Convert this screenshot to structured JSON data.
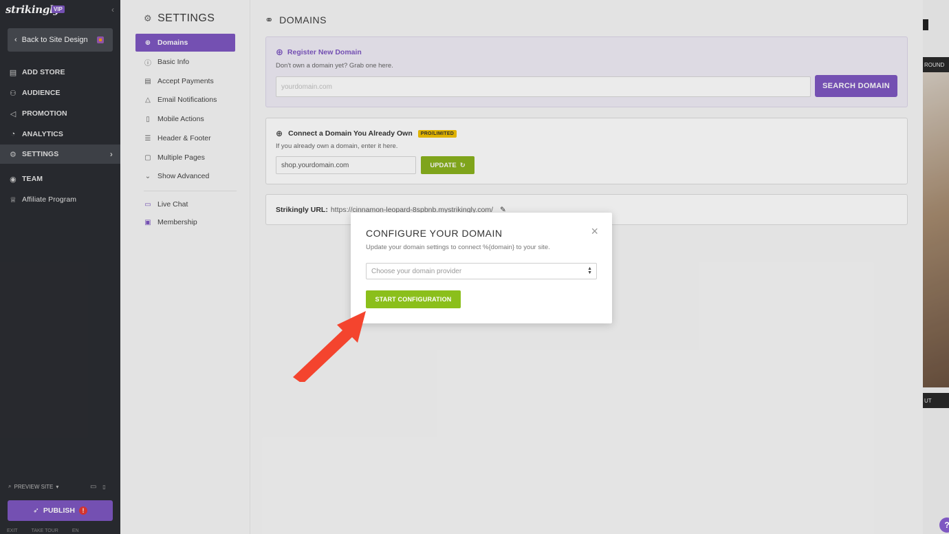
{
  "brand": {
    "name": "strikingly",
    "badge": "VIP"
  },
  "sidebar": {
    "back_label": "Back to Site Design",
    "items": [
      {
        "label": "ADD STORE",
        "icon": "store-icon"
      },
      {
        "label": "AUDIENCE",
        "icon": "audience-icon"
      },
      {
        "label": "PROMOTION",
        "icon": "megaphone-icon"
      },
      {
        "label": "ANALYTICS",
        "icon": "analytics-icon"
      },
      {
        "label": "SETTINGS",
        "icon": "gear-icon"
      },
      {
        "label": "TEAM",
        "icon": "team-icon"
      },
      {
        "label": "Affiliate Program",
        "icon": "trophy-icon"
      }
    ],
    "preview_label": "PREVIEW SITE",
    "publish_label": "PUBLISH",
    "footer_links": [
      "EXIT",
      "TAKE TOUR",
      "EN"
    ]
  },
  "settings": {
    "title": "SETTINGS",
    "items": [
      {
        "label": "Domains"
      },
      {
        "label": "Basic Info"
      },
      {
        "label": "Accept Payments"
      },
      {
        "label": "Email Notifications"
      },
      {
        "label": "Mobile Actions"
      },
      {
        "label": "Header & Footer"
      },
      {
        "label": "Multiple Pages"
      },
      {
        "label": "Show Advanced"
      },
      {
        "label": "Live Chat"
      },
      {
        "label": "Membership"
      }
    ]
  },
  "domains": {
    "title": "DOMAINS",
    "register": {
      "heading": "Register New Domain",
      "subtitle": "Don't own a domain yet? Grab one here.",
      "placeholder": "yourdomain.com",
      "button": "SEARCH DOMAIN"
    },
    "connect": {
      "heading": "Connect a Domain You Already Own",
      "badge": "PRO/LIMITED",
      "subtitle": "If you already own a domain, enter it here.",
      "value": "shop.yourdomain.com",
      "button": "UPDATE"
    },
    "strikingly_url": {
      "label": "Strikingly URL:",
      "value": "https://cinnamon-leopard-8spbnb.mystrikingly.com/"
    }
  },
  "modal": {
    "title": "CONFIGURE YOUR DOMAIN",
    "subtitle": "Update your domain settings to connect %{domain} to your site.",
    "select_placeholder": "Choose your domain provider",
    "button": "START CONFIGURATION"
  },
  "preview_strip": {
    "top_label": "ROUND",
    "bottom_label": "UT",
    "help": "?"
  },
  "colors": {
    "accent": "#7e57c2",
    "green": "#8bbf1b",
    "arrow": "#f4442e",
    "sidebar": "#2b2d32"
  }
}
